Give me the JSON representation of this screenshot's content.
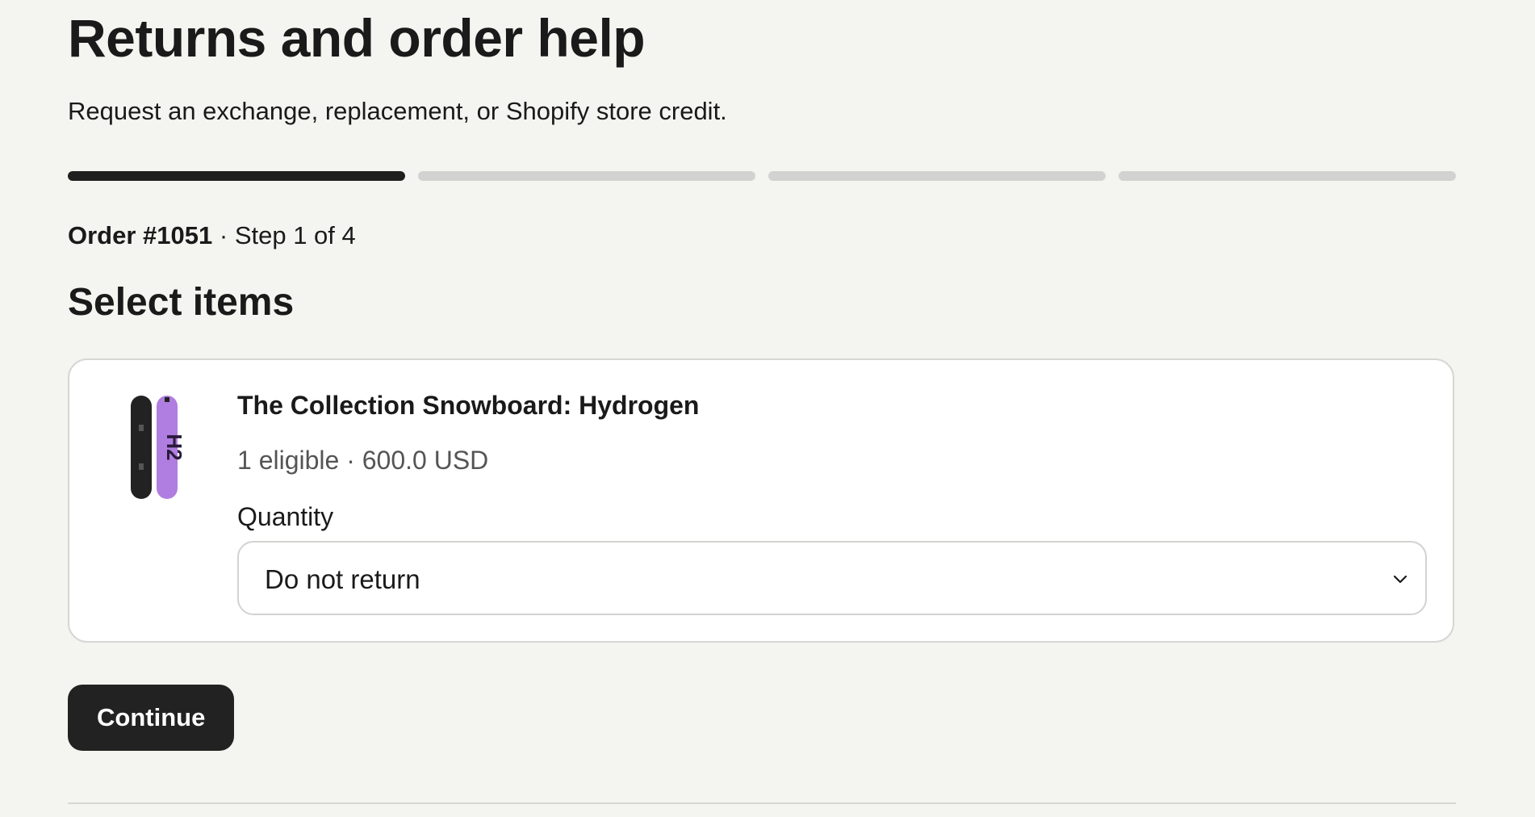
{
  "page": {
    "title": "Returns and order help",
    "subtitle": "Request an exchange, replacement, or Shopify store credit."
  },
  "progress": {
    "current_step": 1,
    "total_steps": 4
  },
  "order": {
    "number": "Order #1051",
    "separator": "·",
    "step_text": "Step 1 of 4"
  },
  "section": {
    "title": "Select items"
  },
  "items": [
    {
      "name": "The Collection Snowboard: Hydrogen",
      "meta": "1 eligible · 600.0 USD",
      "image_icon": "snowboard-image",
      "thumb_colors": {
        "board_dark": "#222222",
        "board_accent": "#b07de0",
        "graphic": "#2a1a3a"
      },
      "quantity_label": "Quantity",
      "quantity_value": "Do not return"
    }
  ],
  "actions": {
    "continue_label": "Continue"
  },
  "colors": {
    "background": "#f4f4f0",
    "progress_active": "#1f1f1f",
    "progress_inactive": "#d2d2d0",
    "button_bg": "#222222",
    "button_text": "#ffffff"
  }
}
